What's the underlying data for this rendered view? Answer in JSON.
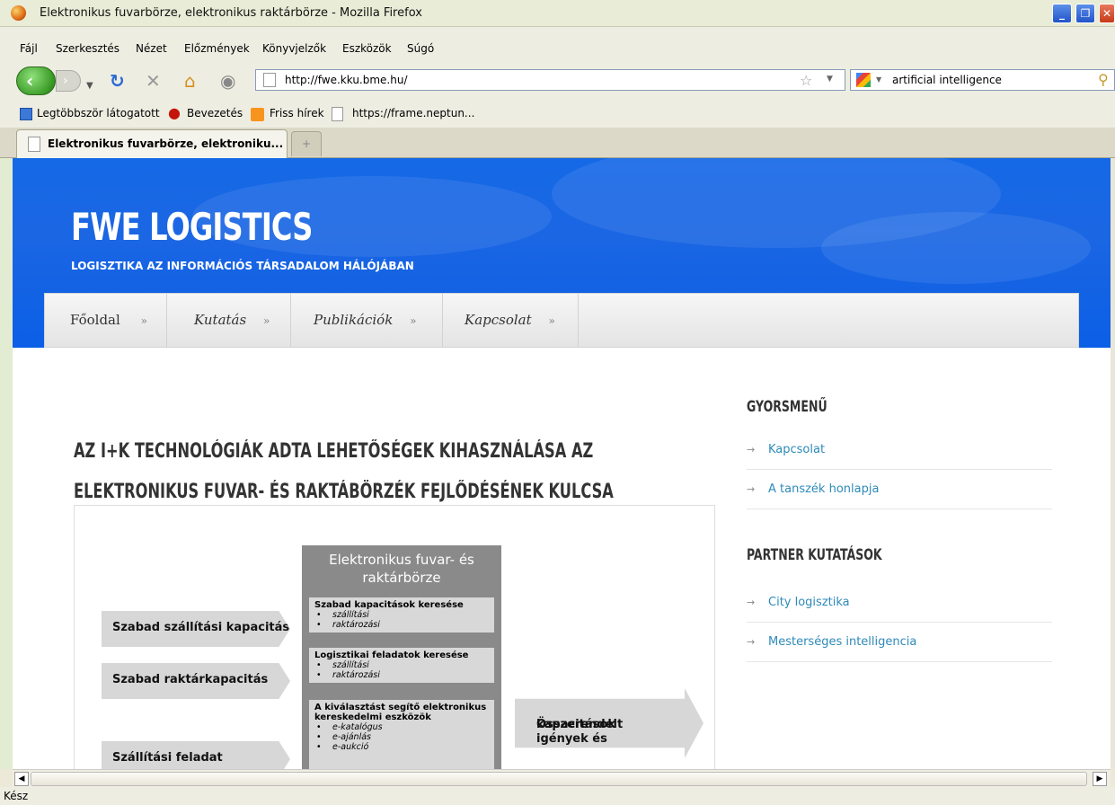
{
  "window": {
    "title": "Elektronikus fuvarbörze, elektronikus raktárbörze - Mozilla Firefox"
  },
  "menu": [
    "Fájl",
    "Szerkesztés",
    "Nézet",
    "Előzmények",
    "Könyvjelzők",
    "Eszközök",
    "Súgó"
  ],
  "nav": {
    "url": "http://fwe.kku.bme.hu/",
    "search_value": "artificial intelligence"
  },
  "bookmarks": [
    "Legtöbbször látogatott",
    "Bevezetés",
    "Friss hírek",
    "https://frame.neptun..."
  ],
  "tabs": [
    {
      "label": "Elektronikus fuvarbörze, elektroniku..."
    }
  ],
  "site": {
    "title": "FWE LOGISTICS",
    "subtitle": "LOGISZTIKA AZ INFORMÁCIÓS TÁRSADALOM HÁLÓJÁBAN",
    "nav": [
      "Főoldal",
      "Kutatás",
      "Publikációk",
      "Kapcsolat"
    ],
    "nav_arrow": "»"
  },
  "article": {
    "heading_line1": "AZ I+K TECHNOLÓGIÁK ADTA LEHETŐSÉGEK KIHASZNÁLÁSA AZ",
    "heading_line2": "ELEKTRONIKUS FUVAR- ÉS RAKTÁBÖRZÉK FEJLŐDÉSÉNEK KULCSA"
  },
  "diagram": {
    "core_title_1": "Elektronikus fuvar- és",
    "core_title_2": "raktárbörze",
    "inputs": [
      "Szabad szállítási kapacitás",
      "Szabad raktárkapacitás",
      "Szállítási feladat"
    ],
    "output": [
      "Összerendelt igények és",
      "kapacitások"
    ],
    "boxes": [
      {
        "title": "Szabad kapacitások keresése",
        "items": [
          "szállítási",
          "raktározási"
        ]
      },
      {
        "title": "Logisztikai feladatok keresése",
        "items": [
          "szállítási",
          "raktározási"
        ]
      },
      {
        "title": "A kiválasztást segítő elektronikus kereskedelmi eszközök",
        "items": [
          "e-katalógus",
          "e-ajánlás",
          "e-aukció"
        ]
      }
    ]
  },
  "sidebar": {
    "section1": "GYORSMENŰ",
    "quick": [
      "Kapcsolat",
      "A tanszék honlapja"
    ],
    "section2": "PARTNER KUTATÁSOK",
    "partners": [
      "City logisztika",
      "Mesterséges intelligencia"
    ],
    "arrow": "→"
  },
  "status": {
    "text": "Kész"
  },
  "colors": {
    "banner": "#1569e6",
    "link": "#2e8ab8"
  }
}
